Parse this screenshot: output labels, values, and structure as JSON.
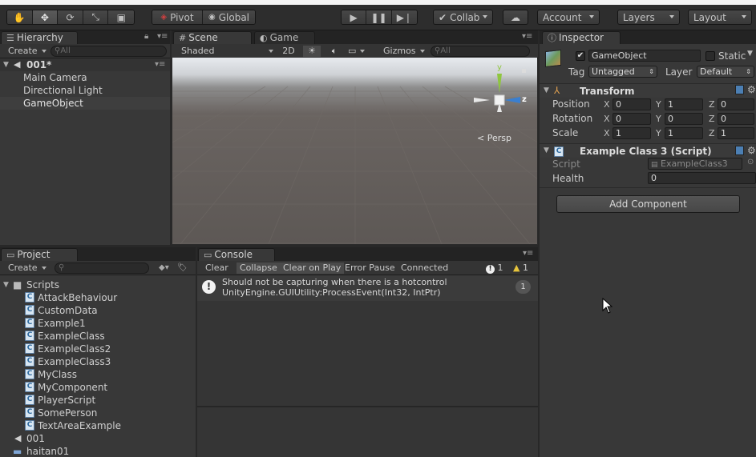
{
  "toolbar": {
    "pivot": "Pivot",
    "global": "Global",
    "collab": "Collab",
    "account": "Account",
    "layers": "Layers",
    "layout": "Layout"
  },
  "hierarchy": {
    "tab": "Hierarchy",
    "create": "Create",
    "search_placeholder": "All",
    "scene": "001*",
    "items": [
      "Main Camera",
      "Directional Light",
      "GameObject"
    ]
  },
  "scene": {
    "tab": "Scene",
    "game_tab": "Game",
    "shading": "Shaded",
    "mode_2d": "2D",
    "gizmos": "Gizmos",
    "search_placeholder": "All",
    "axis_y": "y",
    "axis_z": "z",
    "persp": "< Persp"
  },
  "project": {
    "tab": "Project",
    "create": "Create",
    "scripts_folder": "Scripts",
    "scripts": [
      "AttackBehaviour",
      "CustomData",
      "Example1",
      "ExampleClass",
      "ExampleClass2",
      "ExampleClass3",
      "MyClass",
      "MyComponent",
      "PlayerScript",
      "SomePerson",
      "TextAreaExample"
    ],
    "scene_asset": "001",
    "folder2": "haitan01"
  },
  "console": {
    "tab": "Console",
    "clear": "Clear",
    "collapse": "Collapse",
    "clear_on_play": "Clear on Play",
    "error_pause": "Error Pause",
    "connected": "Connected Playe",
    "info_count": "1",
    "warn_count": "1",
    "message_line1": "Should not be capturing when there is a hotcontrol",
    "message_line2": "UnityEngine.GUIUtility:ProcessEvent(Int32, IntPtr)",
    "message_count": "1"
  },
  "inspector": {
    "tab": "Inspector",
    "object_name": "GameObject",
    "static_label": "Static",
    "tag_label": "Tag",
    "tag_value": "Untagged",
    "layer_label": "Layer",
    "layer_value": "Default",
    "transform_title": "Transform",
    "rows": [
      {
        "label": "Position",
        "x": "0",
        "y": "1",
        "z": "0"
      },
      {
        "label": "Rotation",
        "x": "0",
        "y": "0",
        "z": "0"
      },
      {
        "label": "Scale",
        "x": "1",
        "y": "1",
        "z": "1"
      }
    ],
    "axis_x": "X",
    "axis_y": "Y",
    "axis_z": "Z",
    "script_component_title": "Example Class 3 (Script)",
    "script_label": "Script",
    "script_value": "ExampleClass3",
    "health_label": "Health",
    "health_value": "0",
    "add_component": "Add Component"
  },
  "colors": {
    "panel_bg": "#383838",
    "selection": "#3e3e3e",
    "gizmo_y": "#8fc63f",
    "gizmo_z": "#3a7fd0"
  }
}
